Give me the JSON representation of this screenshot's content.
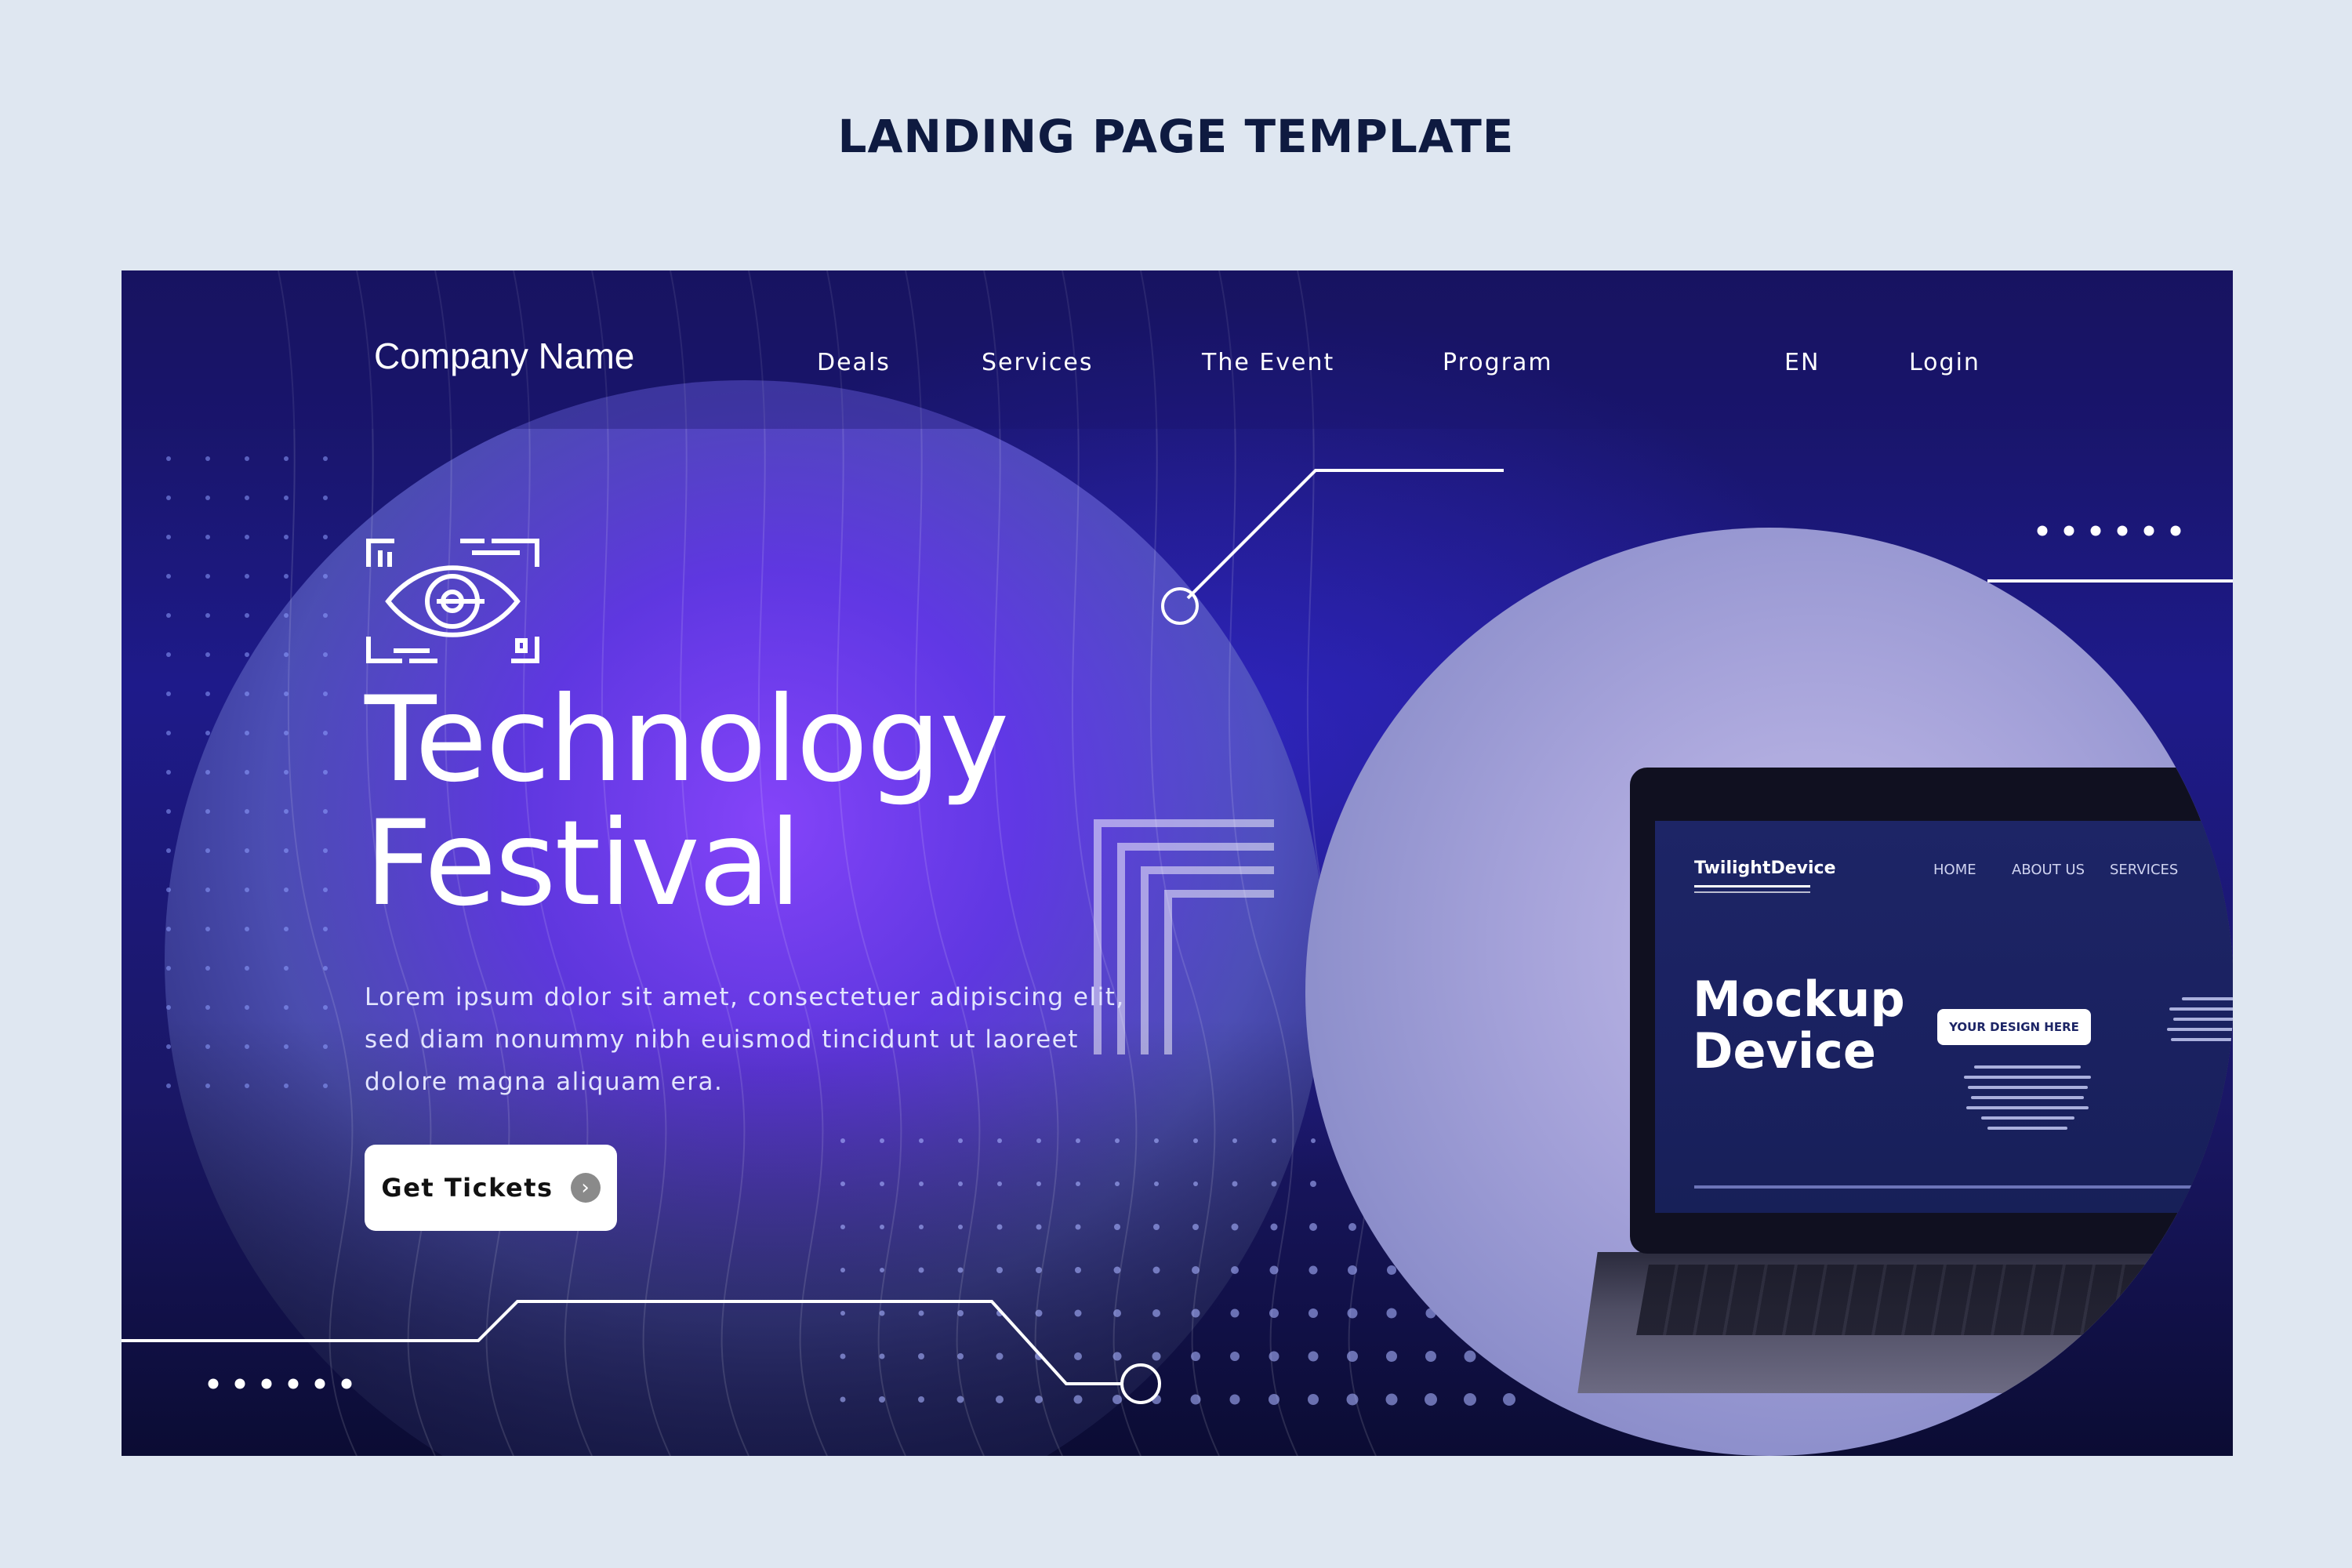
{
  "page": {
    "heading": "LANDING PAGE TEMPLATE"
  },
  "nav": {
    "company": "Company Name",
    "items": [
      "Deals",
      "Services",
      "The Event",
      "Program"
    ],
    "language": "EN",
    "login": "Login"
  },
  "hero": {
    "icon": "eye-scan-icon",
    "title_line1": "Technology",
    "title_line2": "Festival",
    "description": "Lorem ipsum dolor sit amet, consectetuer adipiscing elit, sed diam nonummy nibh euismod tincidunt ut laoreet dolore magna aliquam era.",
    "cta_label": "Get Tickets",
    "cta_icon": "chevron-right-icon"
  },
  "mockup": {
    "brand": "TwilightDevice",
    "nav": [
      "HOME",
      "ABOUT US",
      "SERVICES"
    ],
    "title_line1": "Mockup",
    "title_line2": "Device",
    "button": "YOUR DESIGN HERE"
  },
  "colors": {
    "page_bg": "#dfe7f1",
    "hero_dark": "#16135a",
    "hero_glow": "#6a3cf0",
    "accent_white": "#ffffff"
  }
}
